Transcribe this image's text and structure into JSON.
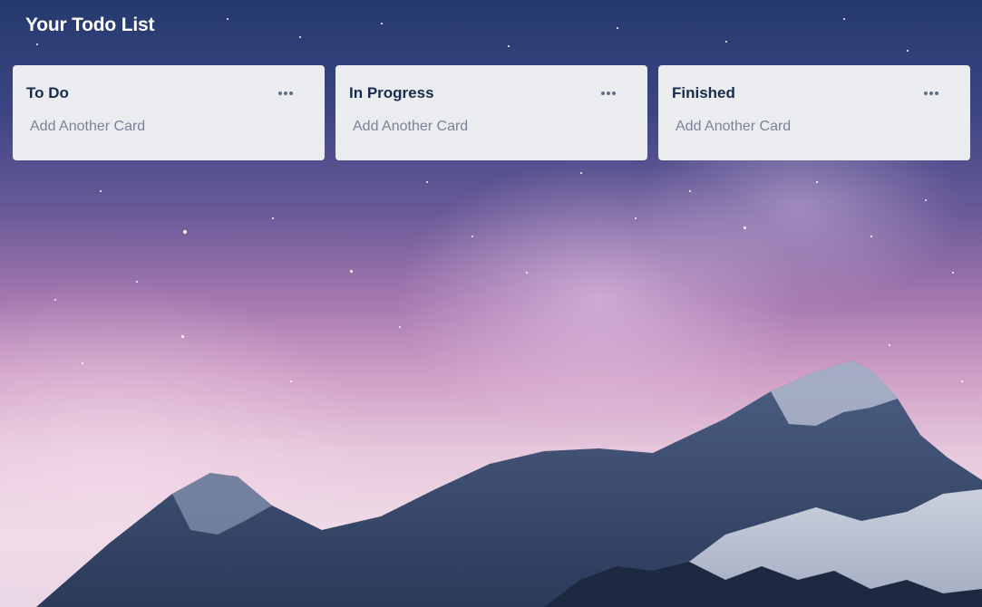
{
  "app": {
    "title": "Your Todo List"
  },
  "lists": [
    {
      "title": "To Do",
      "menu_icon": "more-horizontal-icon",
      "add_card_label": "Add Another Card"
    },
    {
      "title": "In Progress",
      "menu_icon": "more-horizontal-icon",
      "add_card_label": "Add Another Card"
    },
    {
      "title": "Finished",
      "menu_icon": "more-horizontal-icon",
      "add_card_label": "Add Another Card"
    }
  ],
  "colors": {
    "list_background": "#ebecf0",
    "list_title": "#172b4d",
    "add_card_text": "#7a8499",
    "app_title": "#ffffff"
  }
}
